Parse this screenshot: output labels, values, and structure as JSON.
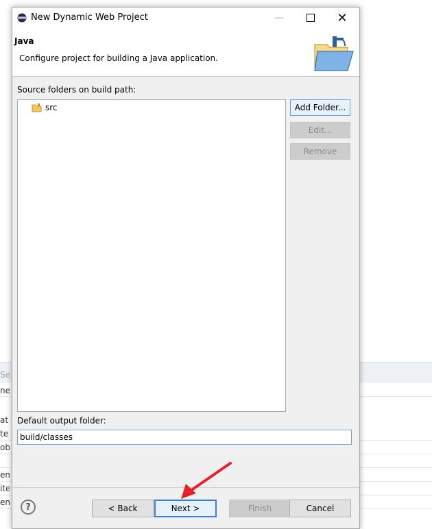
{
  "window": {
    "title": "New Dynamic Web Project"
  },
  "banner": {
    "title": "Java",
    "description": "Configure project for building a Java application."
  },
  "source_folders": {
    "label": "Source folders on build path:",
    "items": [
      "src"
    ]
  },
  "buttons": {
    "add_folder": "Add Folder...",
    "edit": "Edit...",
    "remove": "Remove"
  },
  "output": {
    "label": "Default output folder:",
    "value": "build/classes"
  },
  "footer": {
    "back": "< Back",
    "next": "Next >",
    "finish": "Finish",
    "cancel": "Cancel"
  },
  "background_fragments": [
    "Se",
    "ne",
    "at",
    "te",
    "ob",
    "em",
    "ite",
    "en"
  ],
  "colors": {
    "annotation_arrow": "#e5202a",
    "focus": "#3c7fd0"
  },
  "icons": [
    "eclipse-icon",
    "folder-icon",
    "help-icon",
    "java-folder-graphic"
  ]
}
